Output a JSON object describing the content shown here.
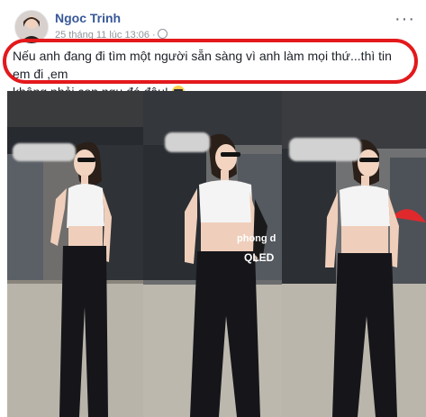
{
  "post": {
    "author": "Ngoc Trinh",
    "timestamp": "25 tháng 11 lúc 13:06 ·",
    "privacy_icon": "globe-icon",
    "more_icon": "more-options-icon",
    "more_label": "···",
    "caption_line1": "Nếu anh đang đi tìm một người sẵn sàng vì anh làm mọi thứ...thì tin em đi ,em",
    "caption_line2": "không phải con ngu đó đâu!",
    "emoji": "sunglasses-emoji",
    "highlight_color": "#e3191c"
  },
  "photos": {
    "count": 3,
    "store_sign": "phong d",
    "sign_text": "QLED"
  }
}
